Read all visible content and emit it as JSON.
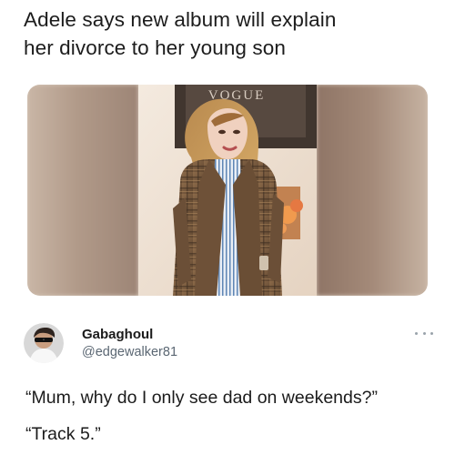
{
  "headline": {
    "line1": "Adele says new album will explain",
    "line2": "her divorce to her young son"
  },
  "media": {
    "cover_masthead": "VOGUE",
    "accent_colors": {
      "jacket": "#7a5a3b",
      "hair": "#c99857",
      "shirt": "#6d8fb8",
      "backdrop": "#efe4d7"
    }
  },
  "post": {
    "display_name": "Gabaghoul",
    "handle": "@edgewalker81",
    "more_icon": "ellipsis-icon",
    "lines": [
      "“Mum, why do I only see dad on weekends?”",
      "“Track 5.”"
    ]
  }
}
